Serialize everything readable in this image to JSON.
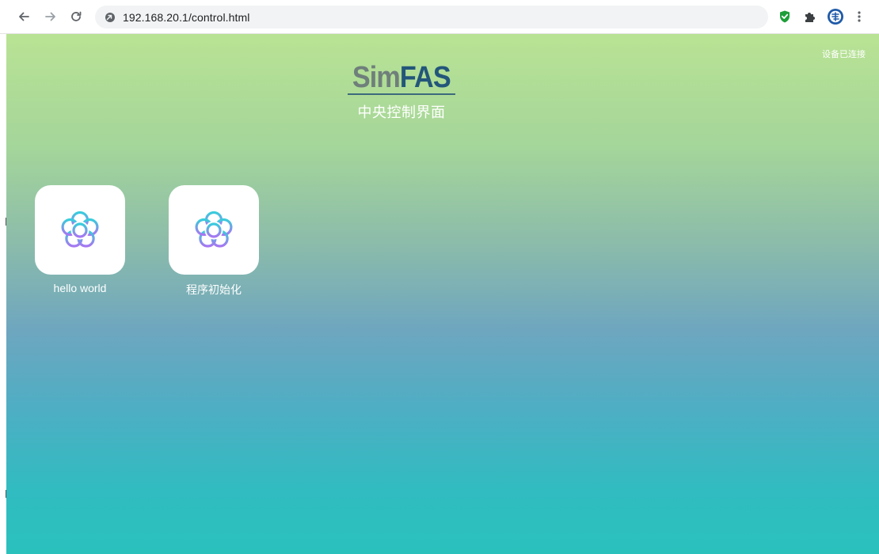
{
  "browser": {
    "url": "192.168.20.1/control.html"
  },
  "header": {
    "status_text": "设备已连接",
    "logo_part1": "Sim",
    "logo_part2": "FAS",
    "subtitle": "中央控制界面"
  },
  "apps": [
    {
      "label": "hello world",
      "icon": "flower-icon"
    },
    {
      "label": "程序初始化",
      "icon": "flower-icon"
    }
  ],
  "colors": {
    "gradient_top": "#b9e394",
    "gradient_middle": "#6ea6bf",
    "gradient_bottom": "#2ac1bd",
    "logo_sim": "#6f7f7b",
    "logo_fas": "#23567a",
    "icon_cyan": "#3fc9d8",
    "icon_purple": "#a47cf0"
  }
}
